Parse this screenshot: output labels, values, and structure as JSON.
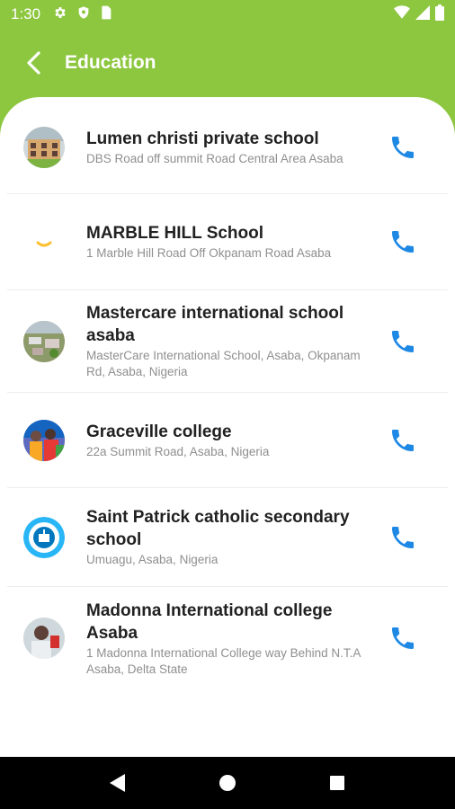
{
  "status_bar": {
    "time": "1:30",
    "icons_left": [
      "gear-icon",
      "shield-icon",
      "sim-card-icon"
    ],
    "icons_right": [
      "wifi-icon",
      "signal-icon",
      "battery-icon"
    ]
  },
  "app_bar": {
    "title": "Education",
    "background": "#8dc63f"
  },
  "schools": [
    {
      "name": "Lumen christi private school",
      "address": "DBS Road off summit Road Central Area Asaba",
      "avatar_icon": "school-building-photo"
    },
    {
      "name": "MARBLE HILL School",
      "address": "1 Marble Hill Road Off Okpanam Road Asaba",
      "avatar_icon": "marble-hill-logo"
    },
    {
      "name": "Mastercare international school asaba",
      "address": "MasterCare International School, Asaba, Okpanam Rd, Asaba, Nigeria",
      "avatar_icon": "aerial-campus-photo"
    },
    {
      "name": "Graceville college",
      "address": "22a Summit Road, Asaba, Nigeria",
      "avatar_icon": "students-photo"
    },
    {
      "name": "Saint Patrick catholic secondary school",
      "address": "Umuagu, Asaba, Nigeria",
      "avatar_icon": "school-crest-logo"
    },
    {
      "name": "Madonna International college Asaba",
      "address": "1 Madonna International College way Behind N.T.A Asaba, Delta State",
      "avatar_icon": "person-photo"
    }
  ],
  "colors": {
    "accent_green": "#8dc63f",
    "phone_blue": "#1e88e5"
  },
  "nav_bar": {
    "buttons": [
      "back-triangle-icon",
      "home-circle-icon",
      "recents-square-icon"
    ]
  }
}
